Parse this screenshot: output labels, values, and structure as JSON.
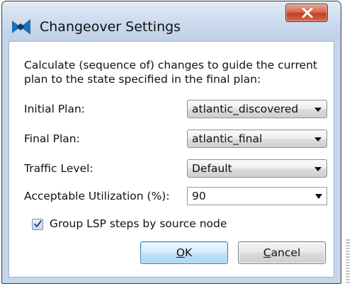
{
  "window": {
    "title": "Changeover Settings",
    "title_icon": "app-logo-icon",
    "close_icon": "close-icon"
  },
  "dialog": {
    "description": "Calculate (sequence of) changes to guide the current plan to the state specified in the final plan:",
    "fields": {
      "initial_plan": {
        "label": "Initial Plan:",
        "value": "atlantic_discovered"
      },
      "final_plan": {
        "label": "Final Plan:",
        "value": "atlantic_final"
      },
      "traffic_level": {
        "label": "Traffic Level:",
        "value": "Default"
      },
      "acceptable_utilization": {
        "label": "Acceptable Utilization (%):",
        "value": "90"
      }
    },
    "group_lsp": {
      "label": "Group LSP steps by source node",
      "checked": true
    },
    "buttons": {
      "ok": {
        "mnemonic": "O",
        "rest": "K"
      },
      "cancel": {
        "mnemonic": "C",
        "rest": "ancel"
      }
    }
  },
  "colors": {
    "titlebar": "#c6d6ea",
    "close_button": "#c94a2f",
    "default_button": "#bfe2f8"
  }
}
